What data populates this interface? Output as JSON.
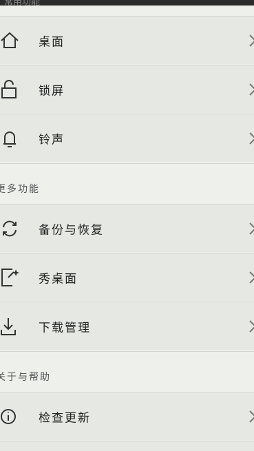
{
  "header": {
    "partial_title": "常用功能"
  },
  "rows": [
    {
      "label": "桌面",
      "icon": "home-icon"
    },
    {
      "label": "锁屏",
      "icon": "lock-icon"
    },
    {
      "label": "铃声",
      "icon": "bell-icon"
    },
    {
      "label": "备份与恢复",
      "icon": "sync-icon"
    },
    {
      "label": "秀桌面",
      "icon": "share-sparkle-icon"
    },
    {
      "label": "下载管理",
      "icon": "download-icon"
    },
    {
      "label": "检查更新",
      "icon": "info-icon"
    }
  ],
  "sections": {
    "more": {
      "title": "更多功能"
    },
    "about": {
      "title": "关于与帮助"
    }
  },
  "colors": {
    "row_bg": "#e6e8e3",
    "page_bg": "#eef0ec",
    "divider": "#d3d6d0",
    "icon_stroke": "#333333"
  }
}
